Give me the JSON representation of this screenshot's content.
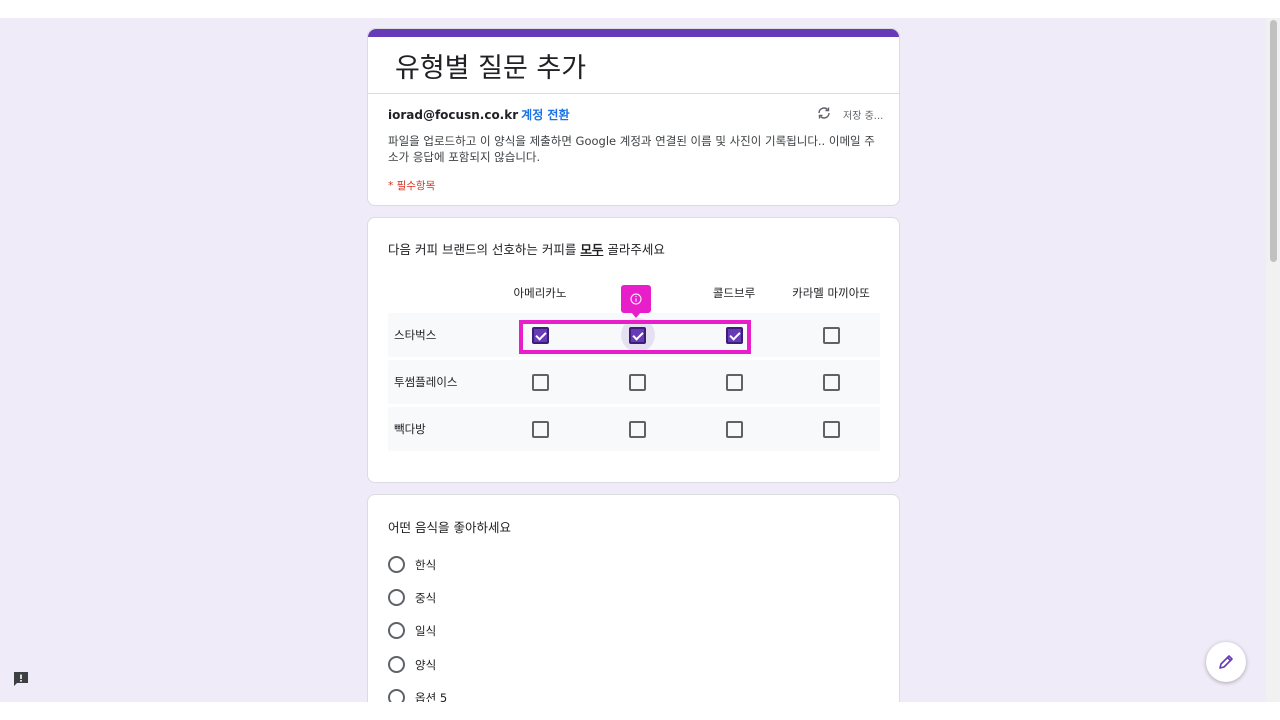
{
  "form": {
    "title": "유형별 질문 추가",
    "account_email": "iorad@focusn.co.kr",
    "switch_account": "계정 전환",
    "saving_status": "저장 중...",
    "description": "파일을 업로드하고 이 양식을 제출하면 Google 계정과 연결된 이름 및 사진이 기록됩니다.. 이메일 주소가 응답에 포함되지 않습니다.",
    "required_note": "* 필수항목"
  },
  "question1": {
    "title_prefix": "다음 커피 브랜드의 선호하는 커피를 ",
    "title_emphasis": "모두",
    "title_suffix": " 골라주세요",
    "columns": [
      "아메리카노",
      "",
      "콜드브루",
      "카라멜 마끼아또"
    ],
    "rows": [
      {
        "label": "스타벅스",
        "checked": [
          true,
          true,
          true,
          false
        ]
      },
      {
        "label": "투썸플레이스",
        "checked": [
          false,
          false,
          false,
          false
        ]
      },
      {
        "label": "빽다방",
        "checked": [
          false,
          false,
          false,
          false
        ]
      }
    ]
  },
  "question2": {
    "title": "어떤 음식을 좋아하세요",
    "options": [
      "한식",
      "중식",
      "일식",
      "양식",
      "옵션 5"
    ]
  },
  "colors": {
    "accent": "#673ab7",
    "highlight": "#e91ecb",
    "background": "#f0ebf8",
    "link": "#1a73e8",
    "required": "#d93025"
  },
  "icons": {
    "sync": "sync-icon",
    "info": "info-icon",
    "feedback": "feedback-icon",
    "edit": "pencil-icon"
  }
}
